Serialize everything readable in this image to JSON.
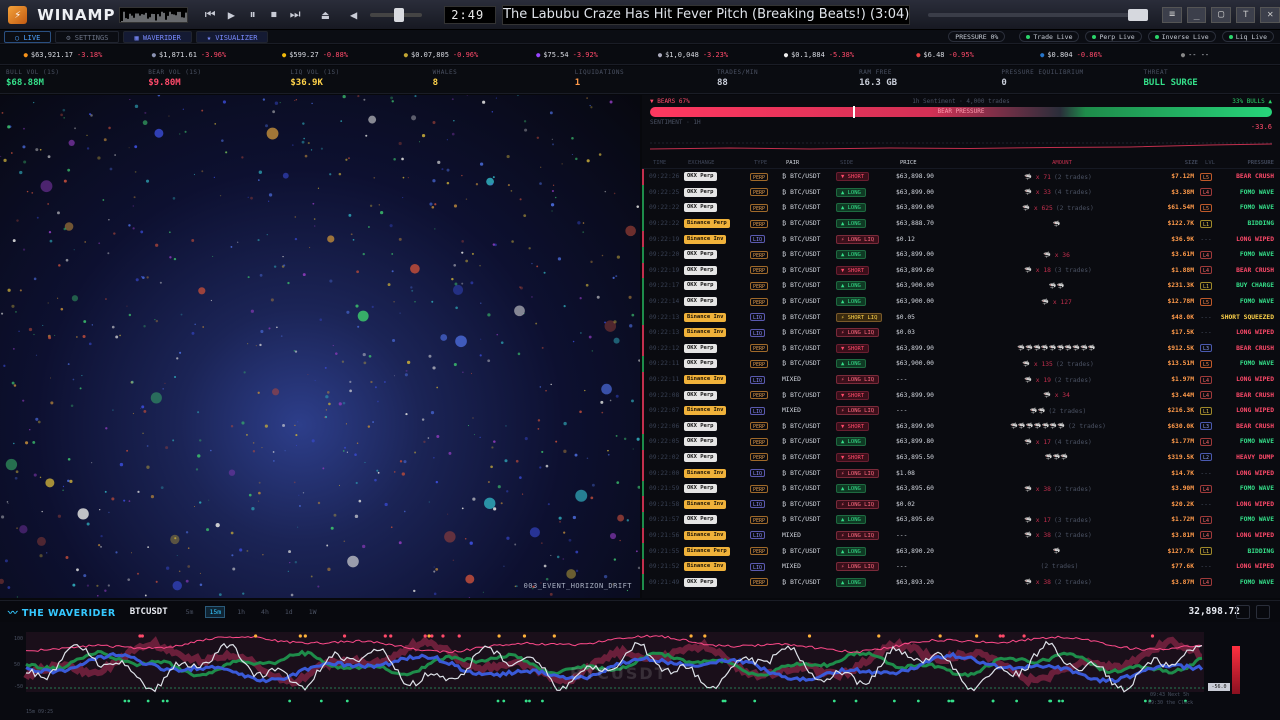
{
  "window": {
    "app_name": "WINAMP",
    "time": "2:49",
    "song": "The Labubu Craze Has Hit Fever Pitch (Breaking Beats!) (3:04)"
  },
  "tabs": [
    {
      "label": "LIVE"
    },
    {
      "label": "SETTINGS"
    },
    {
      "label": "WAVERIDER"
    },
    {
      "label": "VISUALIZER"
    }
  ],
  "status_pills": [
    "PRESSURE 0%",
    "Trade Live",
    "Perp Live",
    "Inverse Live",
    "Liq Live"
  ],
  "tickers": [
    {
      "price": "$63,921.17",
      "change": "-3.18%",
      "color": "#f7931a"
    },
    {
      "price": "$1,871.61",
      "change": "-3.96%",
      "color": "#8a92b2"
    },
    {
      "price": "$599.27",
      "change": "-0.88%",
      "color": "#f0b90b"
    },
    {
      "price": "$0.07,805",
      "change": "-0.96%",
      "color": "#c2a633"
    },
    {
      "price": "$75.54",
      "change": "-3.92%",
      "color": "#9945ff"
    },
    {
      "price": "$1,0,048",
      "change": "-3.23%",
      "color": "#aab"
    },
    {
      "price": "$0.1,884",
      "change": "-5.38%",
      "color": "#eee"
    },
    {
      "price": "$6.48",
      "change": "-0.95%",
      "color": "#e84142"
    },
    {
      "price": "$0.804",
      "change": "-0.86%",
      "color": "#2775ca"
    },
    {
      "price": "-- --",
      "change": "",
      "color": "#888"
    }
  ],
  "stats": [
    {
      "label": "BULL VOL (1S)",
      "value": "$68.88M",
      "color": "#35e08a"
    },
    {
      "label": "BEAR VOL (1S)",
      "value": "$9.80M",
      "color": "#ff4a6a"
    },
    {
      "label": "LIQ VOL (1S)",
      "value": "$36.9K",
      "color": "#ffd34a"
    },
    {
      "label": "WHALES",
      "value": "8",
      "color": "#ffd34a"
    },
    {
      "label": "LIQUIDATIONS",
      "value": "1",
      "color": "#ff9a4a"
    },
    {
      "label": "TRADES/MIN",
      "value": "88",
      "color": "#c9ced9"
    },
    {
      "label": "RAM FREE",
      "value": "16.3 GB",
      "color": "#c9ced9"
    },
    {
      "label": "PRESSURE EQUILIBRIUM",
      "value": "0",
      "color": "#c9ced9"
    },
    {
      "label": "THREAT",
      "value": "BULL SURGE",
      "color": "#35e08a"
    }
  ],
  "visualizer": {
    "preset": "003_EVENT_HORIZON_DRIFT"
  },
  "sentiment": {
    "bears_label": "▼ BEARS 67%",
    "middle_label": "1h Sentiment · 4,000 trades",
    "bulls_label": "33% BULLS ▲",
    "bar_text": "BEAR PRESSURE",
    "mini_label": "SENTIMENT · 1H",
    "mini_value": "-33.6"
  },
  "table": {
    "headers": [
      "TIME",
      "EXCHANGE",
      "TYPE",
      "PAIR",
      "SIDE",
      "PRICE",
      "AMOUNT",
      "SIZE",
      "LVL",
      "PRESSURE"
    ],
    "rows": [
      {
        "t": "09:22:26",
        "ex": "OKX Perp",
        "ty": "PERP",
        "pair": "₿ BTC/USDT",
        "side": "▼ SHORT",
        "sc": "short",
        "price": "$63,898.90",
        "amt": "🦈 x 71",
        "ad": "(2 trades)",
        "size": "$7.12M",
        "lvl": "L5",
        "lc": "l5",
        "pr": "BEAR CRUSH",
        "pc": "red",
        "dir": "r"
      },
      {
        "t": "09:22:25",
        "ex": "OKX Perp",
        "ty": "PERP",
        "pair": "₿ BTC/USDT",
        "side": "▲ LONG",
        "sc": "long",
        "price": "$63,899.00",
        "amt": "🦈 x 33",
        "ad": "(4 trades)",
        "size": "$3.38M",
        "lvl": "L4",
        "lc": "l4",
        "pr": "FOMO WAVE",
        "pc": "green",
        "dir": "g"
      },
      {
        "t": "09:22:22",
        "ex": "OKX Perp",
        "ty": "PERP",
        "pair": "₿ BTC/USDT",
        "side": "▲ LONG",
        "sc": "long",
        "price": "$63,899.00",
        "amt": "🦈 x 625",
        "ad": "(2 trades)",
        "size": "$61.54M",
        "lvl": "L5",
        "lc": "l5",
        "pr": "FOMO WAVE",
        "pc": "green",
        "dir": "g"
      },
      {
        "t": "09:22:22",
        "ex": "Binance Perp",
        "ty": "PERP",
        "pair": "₿ BTC/USDT",
        "side": "▲ LONG",
        "sc": "long",
        "price": "$63,888.70",
        "amt": "🦈",
        "ad": "",
        "size": "$122.7K",
        "lvl": "L1",
        "lc": "",
        "pr": "BIDDING",
        "pc": "green",
        "dir": "g"
      },
      {
        "t": "09:22:19",
        "ex": "Binance Inv",
        "ty": "LIQ",
        "pair": "₿ BTC/USDT",
        "side": "⚡ LONG LIQ",
        "sc": "ll",
        "price": "$0.12",
        "amt": "",
        "ad": "",
        "size": "$36.9K",
        "lvl": "---",
        "lc": "none",
        "pr": "LONG WIPED",
        "pc": "red",
        "dir": "r"
      },
      {
        "t": "09:22:20",
        "ex": "OKX Perp",
        "ty": "PERP",
        "pair": "₿ BTC/USDT",
        "side": "▲ LONG",
        "sc": "long",
        "price": "$63,899.00",
        "amt": "🦈 x 36",
        "ad": "",
        "size": "$3.61M",
        "lvl": "L4",
        "lc": "l4",
        "pr": "FOMO WAVE",
        "pc": "green",
        "dir": "g"
      },
      {
        "t": "09:22:19",
        "ex": "OKX Perp",
        "ty": "PERP",
        "pair": "₿ BTC/USDT",
        "side": "▼ SHORT",
        "sc": "short",
        "price": "$63,899.60",
        "amt": "🦈 x 18",
        "ad": "(3 trades)",
        "size": "$1.88M",
        "lvl": "L4",
        "lc": "l4",
        "pr": "BEAR CRUSH",
        "pc": "red",
        "dir": "r"
      },
      {
        "t": "09:22:17",
        "ex": "OKX Perp",
        "ty": "PERP",
        "pair": "₿ BTC/USDT",
        "side": "▲ LONG",
        "sc": "long",
        "price": "$63,900.00",
        "amt": "🦈🦈",
        "ad": "",
        "size": "$231.3K",
        "lvl": "L1",
        "lc": "",
        "pr": "BUY CHARGE",
        "pc": "green",
        "dir": "g"
      },
      {
        "t": "09:22:14",
        "ex": "OKX Perp",
        "ty": "PERP",
        "pair": "₿ BTC/USDT",
        "side": "▲ LONG",
        "sc": "long",
        "price": "$63,900.00",
        "amt": "🦈 x 127",
        "ad": "",
        "size": "$12.78M",
        "lvl": "L5",
        "lc": "l5",
        "pr": "FOMO WAVE",
        "pc": "green",
        "dir": "g"
      },
      {
        "t": "09:22:13",
        "ex": "Binance Inv",
        "ty": "LIQ",
        "pair": "₿ BTC/USDT",
        "side": "⚡ SHORT LIQ",
        "sc": "sl",
        "price": "$0.05",
        "amt": "",
        "ad": "",
        "size": "$48.0K",
        "lvl": "---",
        "lc": "none",
        "pr": "SHORT SQUEEZED",
        "pc": "yellow",
        "dir": "g"
      },
      {
        "t": "09:22:13",
        "ex": "Binance Inv",
        "ty": "LIQ",
        "pair": "₿ BTC/USDT",
        "side": "⚡ LONG LIQ",
        "sc": "ll",
        "price": "$0.03",
        "amt": "",
        "ad": "",
        "size": "$17.5K",
        "lvl": "---",
        "lc": "none",
        "pr": "LONG WIPED",
        "pc": "red",
        "dir": "r"
      },
      {
        "t": "09:22:12",
        "ex": "OKX Perp",
        "ty": "PERP",
        "pair": "₿ BTC/USDT",
        "side": "▼ SHORT",
        "sc": "short",
        "price": "$63,899.90",
        "amt": "🦈🦈🦈🦈🦈🦈🦈🦈🦈🦈",
        "ad": "",
        "size": "$912.5K",
        "lvl": "L3",
        "lc": "l3",
        "pr": "BEAR CRUSH",
        "pc": "red",
        "dir": "r"
      },
      {
        "t": "09:22:11",
        "ex": "OKX Perp",
        "ty": "PERP",
        "pair": "₿ BTC/USDT",
        "side": "▲ LONG",
        "sc": "long",
        "price": "$63,900.00",
        "amt": "🦈 x 135",
        "ad": "(2 trades)",
        "size": "$13.51M",
        "lvl": "L5",
        "lc": "l5",
        "pr": "FOMO WAVE",
        "pc": "green",
        "dir": "g"
      },
      {
        "t": "09:22:11",
        "ex": "Binance Inv",
        "ty": "LIQ",
        "pair": "MIXED",
        "side": "⚡ LONG LIQ",
        "sc": "ll",
        "price": "---",
        "amt": "🦈 x 19",
        "ad": "(2 trades)",
        "size": "$1.97M",
        "lvl": "L4",
        "lc": "l4",
        "pr": "LONG WIPED",
        "pc": "red",
        "dir": "r"
      },
      {
        "t": "09:22:08",
        "ex": "OKX Perp",
        "ty": "PERP",
        "pair": "₿ BTC/USDT",
        "side": "▼ SHORT",
        "sc": "short",
        "price": "$63,899.90",
        "amt": "🦈 x 34",
        "ad": "",
        "size": "$3.44M",
        "lvl": "L4",
        "lc": "l4",
        "pr": "BEAR CRUSH",
        "pc": "red",
        "dir": "r"
      },
      {
        "t": "09:22:07",
        "ex": "Binance Inv",
        "ty": "LIQ",
        "pair": "MIXED",
        "side": "⚡ LONG LIQ",
        "sc": "ll",
        "price": "---",
        "amt": "🦈🦈",
        "ad": "(2 trades)",
        "size": "$216.3K",
        "lvl": "L1",
        "lc": "",
        "pr": "LONG WIPED",
        "pc": "red",
        "dir": "r"
      },
      {
        "t": "09:22:06",
        "ex": "OKX Perp",
        "ty": "PERP",
        "pair": "₿ BTC/USDT",
        "side": "▼ SHORT",
        "sc": "short",
        "price": "$63,899.90",
        "amt": "🦈🦈🦈🦈🦈🦈🦈",
        "ad": "(2 trades)",
        "size": "$630.0K",
        "lvl": "L3",
        "lc": "l3",
        "pr": "BEAR CRUSH",
        "pc": "red",
        "dir": "r"
      },
      {
        "t": "09:22:05",
        "ex": "OKX Perp",
        "ty": "PERP",
        "pair": "₿ BTC/USDT",
        "side": "▲ LONG",
        "sc": "long",
        "price": "$63,899.80",
        "amt": "🦈 x 17",
        "ad": "(4 trades)",
        "size": "$1.77M",
        "lvl": "L4",
        "lc": "l4",
        "pr": "FOMO WAVE",
        "pc": "green",
        "dir": "g"
      },
      {
        "t": "09:22:02",
        "ex": "OKX Perp",
        "ty": "PERP",
        "pair": "₿ BTC/USDT",
        "side": "▼ SHORT",
        "sc": "short",
        "price": "$63,895.50",
        "amt": "🦈🦈🦈",
        "ad": "",
        "size": "$319.5K",
        "lvl": "L2",
        "lc": "l3",
        "pr": "HEAVY DUMP",
        "pc": "red",
        "dir": "r"
      },
      {
        "t": "09:22:00",
        "ex": "Binance Inv",
        "ty": "LIQ",
        "pair": "₿ BTC/USDT",
        "side": "⚡ LONG LIQ",
        "sc": "ll",
        "price": "$1.08",
        "amt": "",
        "ad": "",
        "size": "$14.7K",
        "lvl": "---",
        "lc": "none",
        "pr": "LONG WIPED",
        "pc": "red",
        "dir": "r"
      },
      {
        "t": "09:21:59",
        "ex": "OKX Perp",
        "ty": "PERP",
        "pair": "₿ BTC/USDT",
        "side": "▲ LONG",
        "sc": "long",
        "price": "$63,895.60",
        "amt": "🦈 x 38",
        "ad": "(2 trades)",
        "size": "$3.90M",
        "lvl": "L4",
        "lc": "l4",
        "pr": "FOMO WAVE",
        "pc": "green",
        "dir": "g"
      },
      {
        "t": "09:21:58",
        "ex": "Binance Inv",
        "ty": "LIQ",
        "pair": "₿ BTC/USDT",
        "side": "⚡ LONG LIQ",
        "sc": "ll",
        "price": "$0.02",
        "amt": "",
        "ad": "",
        "size": "$20.2K",
        "lvl": "---",
        "lc": "none",
        "pr": "LONG WIPED",
        "pc": "red",
        "dir": "r"
      },
      {
        "t": "09:21:57",
        "ex": "OKX Perp",
        "ty": "PERP",
        "pair": "₿ BTC/USDT",
        "side": "▲ LONG",
        "sc": "long",
        "price": "$63,895.60",
        "amt": "🦈 x 17",
        "ad": "(3 trades)",
        "size": "$1.72M",
        "lvl": "L4",
        "lc": "l4",
        "pr": "FOMO WAVE",
        "pc": "green",
        "dir": "g"
      },
      {
        "t": "09:21:56",
        "ex": "Binance Inv",
        "ty": "LIQ",
        "pair": "MIXED",
        "side": "⚡ LONG LIQ",
        "sc": "ll",
        "price": "---",
        "amt": "🦈 x 38",
        "ad": "(2 trades)",
        "size": "$3.81M",
        "lvl": "L4",
        "lc": "l4",
        "pr": "LONG WIPED",
        "pc": "red",
        "dir": "r"
      },
      {
        "t": "09:21:55",
        "ex": "Binance Perp",
        "ty": "PERP",
        "pair": "₿ BTC/USDT",
        "side": "▲ LONG",
        "sc": "long",
        "price": "$63,890.20",
        "amt": "🦈",
        "ad": "",
        "size": "$127.7K",
        "lvl": "L1",
        "lc": "",
        "pr": "BIDDING",
        "pc": "green",
        "dir": "g"
      },
      {
        "t": "09:21:52",
        "ex": "Binance Inv",
        "ty": "LIQ",
        "pair": "MIXED",
        "side": "⚡ LONG LIQ",
        "sc": "ll",
        "price": "---",
        "amt": "",
        "ad": "(2 trades)",
        "size": "$77.6K",
        "lvl": "---",
        "lc": "none",
        "pr": "LONG WIPED",
        "pc": "red",
        "dir": "r"
      },
      {
        "t": "09:21:49",
        "ex": "OKX Perp",
        "ty": "PERP",
        "pair": "₿ BTC/USDT",
        "side": "▲ LONG",
        "sc": "long",
        "price": "$63,893.20",
        "amt": "🦈 x 38",
        "ad": "(2 trades)",
        "size": "$3.87M",
        "lvl": "L4",
        "lc": "l4",
        "pr": "FOMO WAVE",
        "pc": "green",
        "dir": "g"
      }
    ]
  },
  "waverider": {
    "title": "THE WAVERIDER",
    "pair": "BTCUSDT",
    "timeframes": [
      "5m",
      "15m",
      "1h",
      "4h",
      "1d",
      "1W"
    ],
    "active_tf": "15m",
    "price": "32,898.72",
    "watermark": "BTCUSDT",
    "y_tick_top": "100",
    "y_tick_mid": "50",
    "y_tick_low": "-50",
    "price_tag": "-56.0",
    "foot_left": "15m  09:25",
    "foot_right_1": "09:43  Next 5h",
    "foot_right_2": "09:30  the Clock"
  }
}
